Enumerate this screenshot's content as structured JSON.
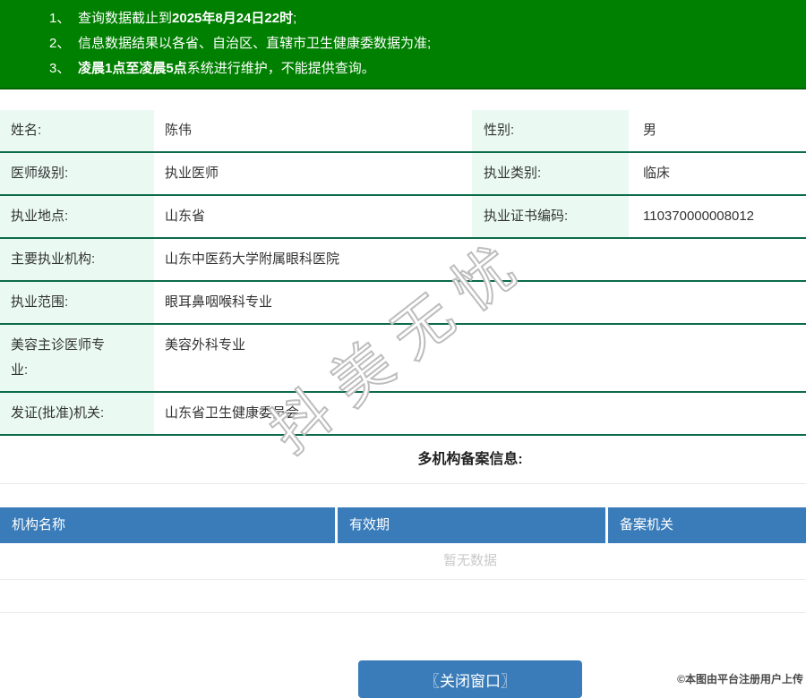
{
  "colors": {
    "banner_green": "#008000",
    "row_divider_green": "#0c6b4a",
    "label_mint": "#eafaf3",
    "table_header_blue": "#3a7cb9",
    "button_blue": "#3a7cb9",
    "empty_text_gray": "#c9c9c9"
  },
  "banner": {
    "notices": [
      {
        "num": "1、",
        "pre": "查询数据截止到",
        "bold": "2025年8月24日22时",
        "post": ";"
      },
      {
        "num": "2、",
        "pre": "信息数据结果以各省、自治区、直辖市卫生健康委数据为准;",
        "bold": "",
        "post": ""
      },
      {
        "num": "3、",
        "pre": "",
        "bold": "凌晨1点至凌晨5点",
        "post": "系统进行维护，不能提供查询。"
      }
    ]
  },
  "info": {
    "rows": [
      {
        "label1": "姓名:",
        "value1": "陈伟",
        "label2": "性别:",
        "value2": "男"
      },
      {
        "label1": "医师级别:",
        "value1": "执业医师",
        "label2": "执业类别:",
        "value2": "临床"
      },
      {
        "label1": "执业地点:",
        "value1": "山东省",
        "label2": "执业证书编码:",
        "value2": "110370000008012"
      },
      {
        "label1": "主要执业机构:",
        "value1": "山东中医药大学附属眼科医院"
      },
      {
        "label1": "执业范围:",
        "value1": "眼耳鼻咽喉科专业"
      },
      {
        "label1": "美容主诊医师专\n业:",
        "value1": "美容外科专业"
      },
      {
        "label1": "发证(批准)机关:",
        "value1": "山东省卫生健康委员会"
      }
    ]
  },
  "filing": {
    "title": "多机构备案信息:",
    "columns": [
      "机构名称",
      "有效期",
      "备案机关"
    ],
    "empty_text": "暂无数据"
  },
  "footer": {
    "close_button": "〖关闭窗口〗"
  },
  "overlay": {
    "diagonal_watermark": "抖美无忧",
    "copyright": "©本图由平台注册用户上传"
  }
}
